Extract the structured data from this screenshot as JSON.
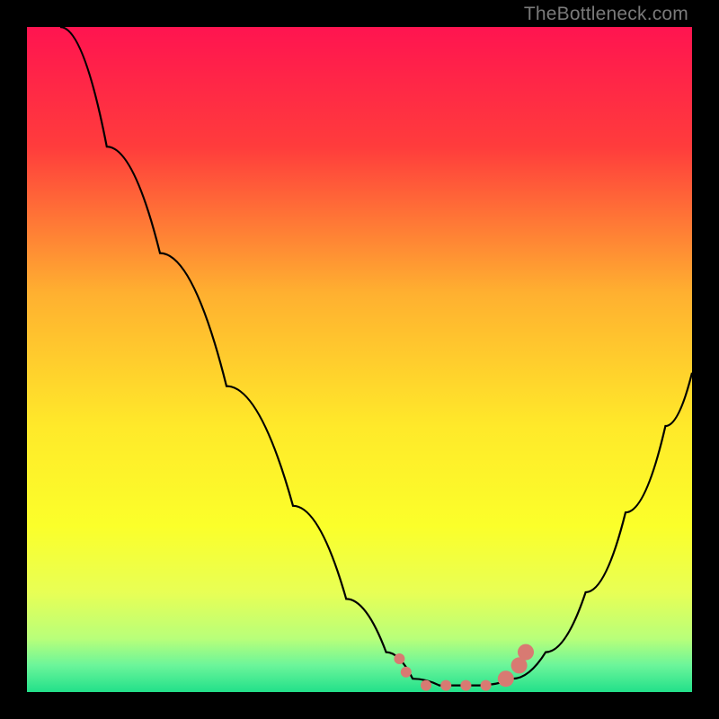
{
  "watermark": "TheBottleneck.com",
  "chart_data": {
    "type": "line",
    "title": "",
    "xlabel": "",
    "ylabel": "",
    "xlim": [
      0,
      100
    ],
    "ylim": [
      0,
      100
    ],
    "gradient_stops": [
      {
        "offset": 0,
        "color": "#ff1450"
      },
      {
        "offset": 18,
        "color": "#ff3c3c"
      },
      {
        "offset": 40,
        "color": "#ffb030"
      },
      {
        "offset": 60,
        "color": "#ffe92a"
      },
      {
        "offset": 75,
        "color": "#fbff2a"
      },
      {
        "offset": 85,
        "color": "#e8ff55"
      },
      {
        "offset": 92,
        "color": "#b8ff7a"
      },
      {
        "offset": 96,
        "color": "#6bf59a"
      },
      {
        "offset": 100,
        "color": "#22e08a"
      }
    ],
    "series": [
      {
        "name": "bottleneck-curve",
        "stroke": "#000000",
        "points": [
          {
            "x": 5,
            "y": 100
          },
          {
            "x": 12,
            "y": 82
          },
          {
            "x": 20,
            "y": 66
          },
          {
            "x": 30,
            "y": 46
          },
          {
            "x": 40,
            "y": 28
          },
          {
            "x": 48,
            "y": 14
          },
          {
            "x": 54,
            "y": 6
          },
          {
            "x": 58,
            "y": 2
          },
          {
            "x": 62,
            "y": 1
          },
          {
            "x": 68,
            "y": 1
          },
          {
            "x": 73,
            "y": 2
          },
          {
            "x": 78,
            "y": 6
          },
          {
            "x": 84,
            "y": 15
          },
          {
            "x": 90,
            "y": 27
          },
          {
            "x": 96,
            "y": 40
          },
          {
            "x": 100,
            "y": 48
          }
        ]
      }
    ],
    "markers": {
      "name": "highlight-dots",
      "fill": "#d87a72",
      "points": [
        {
          "x": 56,
          "y": 5
        },
        {
          "x": 57,
          "y": 3
        },
        {
          "x": 60,
          "y": 1
        },
        {
          "x": 63,
          "y": 1
        },
        {
          "x": 66,
          "y": 1
        },
        {
          "x": 69,
          "y": 1
        },
        {
          "x": 72,
          "y": 2
        },
        {
          "x": 74,
          "y": 4
        },
        {
          "x": 75,
          "y": 6
        }
      ],
      "radius_small": 6,
      "radius_large": 9
    }
  }
}
